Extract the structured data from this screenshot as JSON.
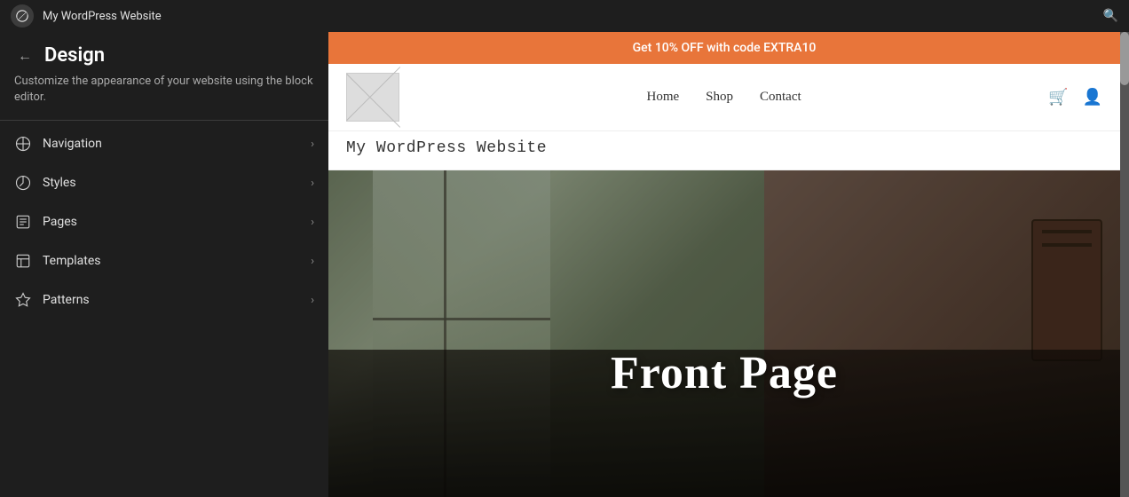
{
  "topbar": {
    "site_name": "My WordPress Website",
    "search_placeholder": "Search"
  },
  "sidebar": {
    "back_label": "←",
    "title": "Design",
    "description": "Customize the appearance of your website using the block editor.",
    "menu_items": [
      {
        "id": "navigation",
        "label": "Navigation",
        "icon": "navigation-icon"
      },
      {
        "id": "styles",
        "label": "Styles",
        "icon": "styles-icon"
      },
      {
        "id": "pages",
        "label": "Pages",
        "icon": "pages-icon"
      },
      {
        "id": "templates",
        "label": "Templates",
        "icon": "templates-icon"
      },
      {
        "id": "patterns",
        "label": "Patterns",
        "icon": "patterns-icon"
      }
    ]
  },
  "preview": {
    "promo_banner": "Get 10% OFF with code EXTRA10",
    "nav_links": [
      "Home",
      "Shop",
      "Contact"
    ],
    "site_name": "My WordPress Website",
    "hero_text": "Front Page"
  }
}
